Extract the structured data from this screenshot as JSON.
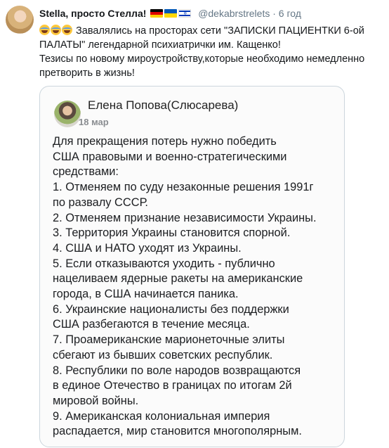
{
  "tweet": {
    "author_name": "Stella, просто Стелла!",
    "handle": "@dekabrstrelets",
    "dot": "·",
    "time": "6 год",
    "text_line1": "Завалялись на просторах сети \"ЗАПИСКИ ПАЦИЕНТКИ 6-ой ПАЛАТЫ\" легендарной психиатрички им. Кащенко!",
    "text_line2": "Тезисы по новому мироустройству,которые необходимо немедленно претворить в жизнь!"
  },
  "icons": {
    "flags": [
      "germany-flag-icon",
      "ukraine-flag-icon",
      "israel-flag-icon"
    ],
    "emoji": [
      "rofl-emoji-icon",
      "rofl-emoji-icon",
      "rofl-emoji-icon"
    ]
  },
  "embedded_post": {
    "author": "Елена Попова(Слюсарева)",
    "date": "18 мар",
    "lines": [
      "Для прекращения потерь нужно победить",
      "США правовыми и военно-стратегическими",
      "средствами:",
      "1. Отменяем по суду незаконные решения 1991г",
      "по развалу СССР.",
      "2. Отменяем признание независимости Украины.",
      "3. Территория Украины становится спорной.",
      "4. США и НАТО уходят из Украины.",
      "5. Если отказываются уходить - публично",
      "нацеливаем ядерные ракеты на американские",
      "города, в США начинается паника.",
      "6. Украинские националисты без поддержки",
      "США разбегаются в течение месяца.",
      "7. Проамериканские марионеточные элиты",
      "сбегают из бывших советских республик.",
      "8. Республики по воле народов возвращаются",
      "в единое Отечество в границах по итогам 2й",
      "мировой войны.",
      "9. Американская колониальная империя",
      "распадается, мир становится многополярным."
    ]
  }
}
